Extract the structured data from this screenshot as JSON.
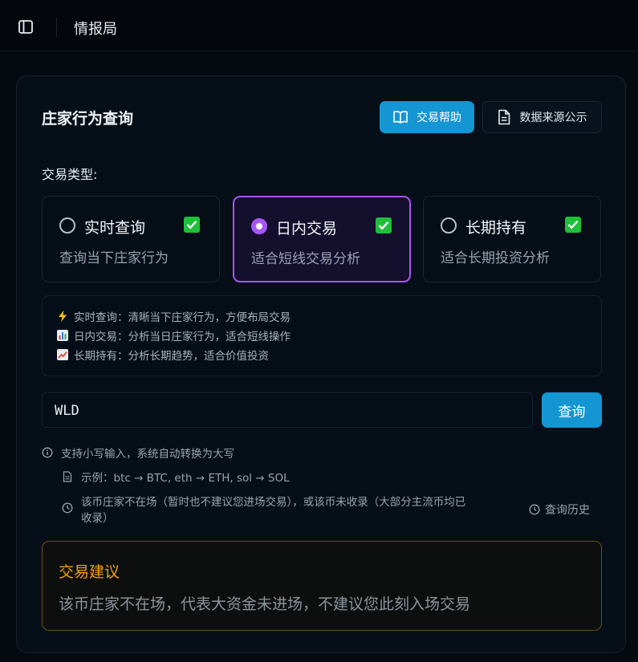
{
  "app": {
    "title": "情报局"
  },
  "card": {
    "title": "庄家行为查询",
    "help_button": "交易帮助",
    "source_button": "数据来源公示"
  },
  "trade_type": {
    "label": "交易类型:",
    "options": [
      {
        "name": "实时查询",
        "desc": "查询当下庄家行为",
        "selected": false,
        "checked": true
      },
      {
        "name": "日内交易",
        "desc": "适合短线交易分析",
        "selected": true,
        "checked": true
      },
      {
        "name": "长期持有",
        "desc": "适合长期投资分析",
        "selected": false,
        "checked": true
      }
    ]
  },
  "info": {
    "lines": [
      {
        "icon": "lightning-icon",
        "text": "实时查询：清晰当下庄家行为，方便布局交易"
      },
      {
        "icon": "bar-chart-icon",
        "text": "日内交易：分析当日庄家行为，适合短线操作"
      },
      {
        "icon": "trend-up-icon",
        "text": "长期持有：分析长期趋势，适合价值投资"
      }
    ]
  },
  "search": {
    "value": "WLD",
    "button": "查询"
  },
  "hints": {
    "case_hint": "支持小写输入，系统自动转换为大写",
    "example": "示例：btc → BTC, eth → ETH, sol → SOL",
    "not_present_line1": "该币庄家不在场（暂时也不建议您进场交易），或该币未收录（大部分主流币均已",
    "not_present_line2": "收录）",
    "history": "查询历史"
  },
  "advice": {
    "title": "交易建议",
    "text": "该币庄家不在场，代表大资金未进场，不建议您此刻入场交易"
  },
  "colors": {
    "accent_blue": "#1496d2",
    "selected_purple": "#a855f7",
    "check_green": "#1fbf3a",
    "advice_orange": "#f59e0b"
  }
}
